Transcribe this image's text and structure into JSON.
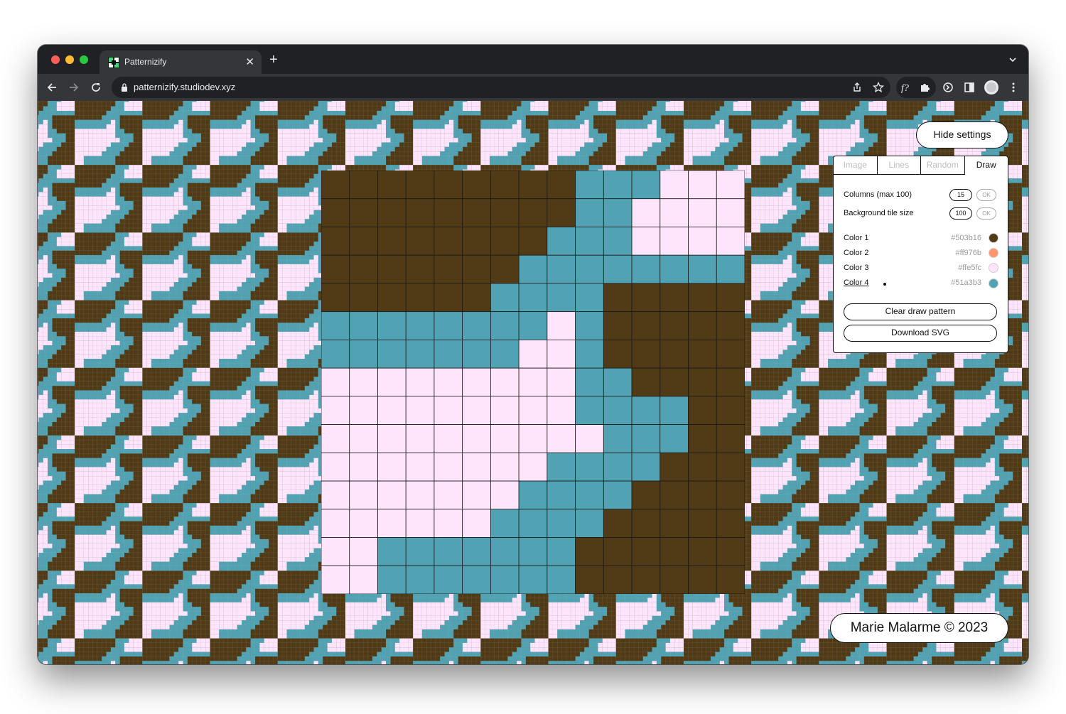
{
  "browser": {
    "tab_title": "Patternizify",
    "url": "patternizify.studiodev.xyz"
  },
  "pattern": {
    "colors": [
      "#503b16",
      "#ff976b",
      "#ffe5fc",
      "#51a3b3"
    ],
    "columns": 15,
    "cells": [
      "000000000333222",
      "000000000332222",
      "000000003332222",
      "000000033333333",
      "000000333300000",
      "333333332300000",
      "333333322300000",
      "222222222330000",
      "222222222333300",
      "222222222233300",
      "222222223333000",
      "222222233330000",
      "222222333300000",
      "223333333000000",
      "223333333000000"
    ]
  },
  "settings": {
    "hide_label": "Hide settings",
    "tabs": [
      {
        "label": "Image",
        "active": false
      },
      {
        "label": "Lines",
        "active": false
      },
      {
        "label": "Random",
        "active": false
      },
      {
        "label": "Draw",
        "active": true
      }
    ],
    "columns_label": "Columns (max 100)",
    "columns_value": "15",
    "bg_tile_label": "Background tile size",
    "bg_tile_value": "100",
    "ok_label": "OK",
    "color_rows": [
      {
        "label": "Color 1",
        "hex": "#503b16"
      },
      {
        "label": "Color 2",
        "hex": "#ff976b"
      },
      {
        "label": "Color 3",
        "hex": "#ffe5fc"
      },
      {
        "label": "Color 4",
        "hex": "#51a3b3"
      }
    ],
    "selected_color": "Color 4",
    "clear_label": "Clear draw pattern",
    "download_label": "Download SVG"
  },
  "footer": {
    "credit": "Marie Malarme © 2023"
  }
}
